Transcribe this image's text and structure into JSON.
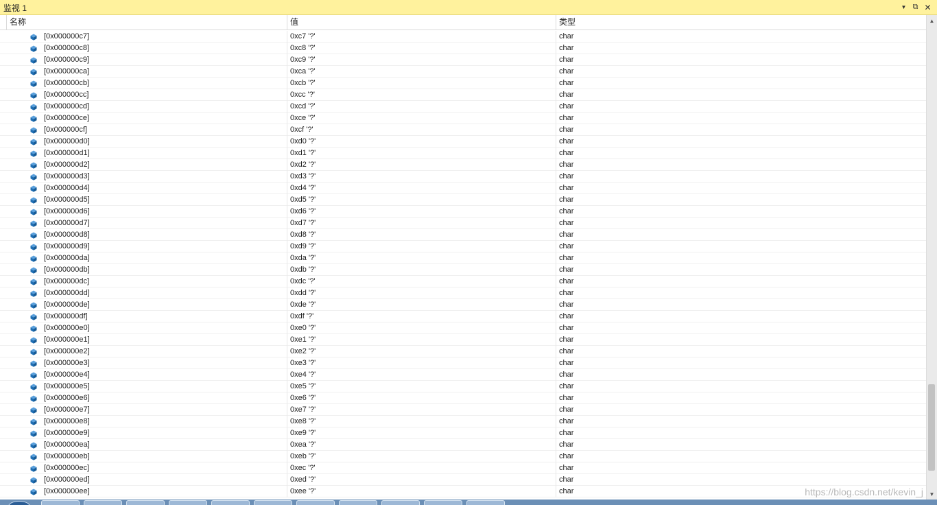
{
  "window": {
    "title": "监视 1",
    "dropdown_icon": "▼",
    "float_icon": "⧉",
    "close_icon": "✕"
  },
  "columns": {
    "name": "名称",
    "value": "值",
    "type": "类型"
  },
  "rows": [
    {
      "name": "[0x000000c7]",
      "value": "0xc7 '?'",
      "type": "char"
    },
    {
      "name": "[0x000000c8]",
      "value": "0xc8 '?'",
      "type": "char"
    },
    {
      "name": "[0x000000c9]",
      "value": "0xc9 '?'",
      "type": "char"
    },
    {
      "name": "[0x000000ca]",
      "value": "0xca '?'",
      "type": "char"
    },
    {
      "name": "[0x000000cb]",
      "value": "0xcb '?'",
      "type": "char"
    },
    {
      "name": "[0x000000cc]",
      "value": "0xcc '?'",
      "type": "char"
    },
    {
      "name": "[0x000000cd]",
      "value": "0xcd '?'",
      "type": "char"
    },
    {
      "name": "[0x000000ce]",
      "value": "0xce '?'",
      "type": "char"
    },
    {
      "name": "[0x000000cf]",
      "value": "0xcf '?'",
      "type": "char"
    },
    {
      "name": "[0x000000d0]",
      "value": "0xd0 '?'",
      "type": "char"
    },
    {
      "name": "[0x000000d1]",
      "value": "0xd1 '?'",
      "type": "char"
    },
    {
      "name": "[0x000000d2]",
      "value": "0xd2 '?'",
      "type": "char"
    },
    {
      "name": "[0x000000d3]",
      "value": "0xd3 '?'",
      "type": "char"
    },
    {
      "name": "[0x000000d4]",
      "value": "0xd4 '?'",
      "type": "char"
    },
    {
      "name": "[0x000000d5]",
      "value": "0xd5 '?'",
      "type": "char"
    },
    {
      "name": "[0x000000d6]",
      "value": "0xd6 '?'",
      "type": "char"
    },
    {
      "name": "[0x000000d7]",
      "value": "0xd7 '?'",
      "type": "char"
    },
    {
      "name": "[0x000000d8]",
      "value": "0xd8 '?'",
      "type": "char"
    },
    {
      "name": "[0x000000d9]",
      "value": "0xd9 '?'",
      "type": "char"
    },
    {
      "name": "[0x000000da]",
      "value": "0xda '?'",
      "type": "char"
    },
    {
      "name": "[0x000000db]",
      "value": "0xdb '?'",
      "type": "char"
    },
    {
      "name": "[0x000000dc]",
      "value": "0xdc '?'",
      "type": "char"
    },
    {
      "name": "[0x000000dd]",
      "value": "0xdd '?'",
      "type": "char"
    },
    {
      "name": "[0x000000de]",
      "value": "0xde '?'",
      "type": "char"
    },
    {
      "name": "[0x000000df]",
      "value": "0xdf '?'",
      "type": "char"
    },
    {
      "name": "[0x000000e0]",
      "value": "0xe0 '?'",
      "type": "char"
    },
    {
      "name": "[0x000000e1]",
      "value": "0xe1 '?'",
      "type": "char"
    },
    {
      "name": "[0x000000e2]",
      "value": "0xe2 '?'",
      "type": "char"
    },
    {
      "name": "[0x000000e3]",
      "value": "0xe3 '?'",
      "type": "char"
    },
    {
      "name": "[0x000000e4]",
      "value": "0xe4 '?'",
      "type": "char"
    },
    {
      "name": "[0x000000e5]",
      "value": "0xe5 '?'",
      "type": "char"
    },
    {
      "name": "[0x000000e6]",
      "value": "0xe6 '?'",
      "type": "char"
    },
    {
      "name": "[0x000000e7]",
      "value": "0xe7 '?'",
      "type": "char"
    },
    {
      "name": "[0x000000e8]",
      "value": "0xe8 '?'",
      "type": "char"
    },
    {
      "name": "[0x000000e9]",
      "value": "0xe9 '?'",
      "type": "char"
    },
    {
      "name": "[0x000000ea]",
      "value": "0xea '?'",
      "type": "char"
    },
    {
      "name": "[0x000000eb]",
      "value": "0xeb '?'",
      "type": "char"
    },
    {
      "name": "[0x000000ec]",
      "value": "0xec '?'",
      "type": "char"
    },
    {
      "name": "[0x000000ed]",
      "value": "0xed '?'",
      "type": "char"
    },
    {
      "name": "[0x000000ee]",
      "value": "0xee '?'",
      "type": "char"
    }
  ],
  "row_icon": "cube-icon",
  "watermark": "https://blog.csdn.net/kevin_j",
  "colors": {
    "titlebar": "#fff29d",
    "icon_blue": "#1f6fb5",
    "taskbar": "#6b8fb6"
  }
}
